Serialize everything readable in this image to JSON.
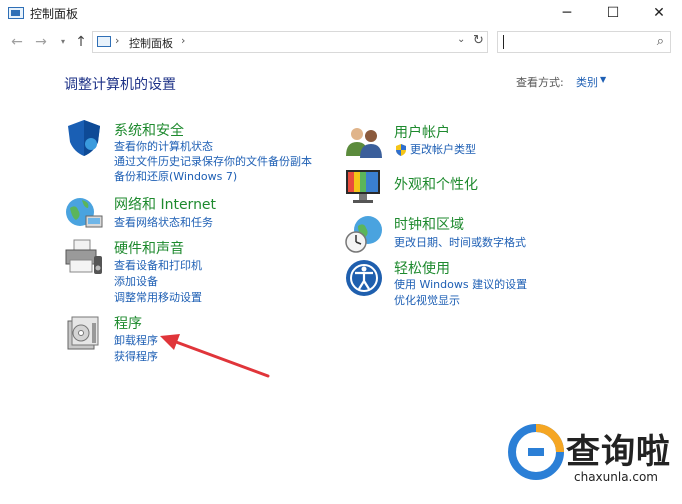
{
  "window": {
    "title": "控制面板",
    "minimize": "─",
    "maximize": "☐",
    "close": "✕"
  },
  "nav": {
    "back": "←",
    "forward": "→",
    "recent": "▾",
    "up": "↑",
    "address_separator": "›",
    "address_text": "控制面板",
    "dropdown": "⌄",
    "refresh": "↻",
    "search_placeholder": "",
    "search_glyph": "⌕"
  },
  "main": {
    "heading": "调整计算机的设置",
    "view_by_label": "查看方式:",
    "view_by_value": "类别",
    "view_by_arrow": "▼"
  },
  "categories": {
    "system": {
      "title": "系统和安全",
      "links": [
        "查看你的计算机状态",
        "通过文件历史记录保存你的文件备份副本",
        "备份和还原(Windows 7)"
      ]
    },
    "network": {
      "title": "网络和 Internet",
      "links": [
        "查看网络状态和任务"
      ]
    },
    "hardware": {
      "title": "硬件和声音",
      "links": [
        "查看设备和打印机",
        "添加设备",
        "调整常用移动设置"
      ]
    },
    "programs": {
      "title": "程序",
      "links": [
        "卸载程序",
        "获得程序"
      ]
    },
    "users": {
      "title": "用户帐户",
      "links": [
        "更改帐户类型"
      ]
    },
    "appearance": {
      "title": "外观和个性化",
      "links": []
    },
    "clock": {
      "title": "时钟和区域",
      "links": [
        "更改日期、时间或数字格式"
      ]
    },
    "ease": {
      "title": "轻松使用",
      "links": [
        "使用 Windows 建议的设置",
        "优化视觉显示"
      ]
    }
  },
  "watermark": {
    "cn": "查询啦",
    "en": "chaxunla.com"
  },
  "colors": {
    "heading": "#1e3287",
    "category_title": "#1e8a2e",
    "link": "#1e5fb4",
    "annotation_arrow": "#e0353a",
    "watermark_accent": "#2b7fd6"
  }
}
